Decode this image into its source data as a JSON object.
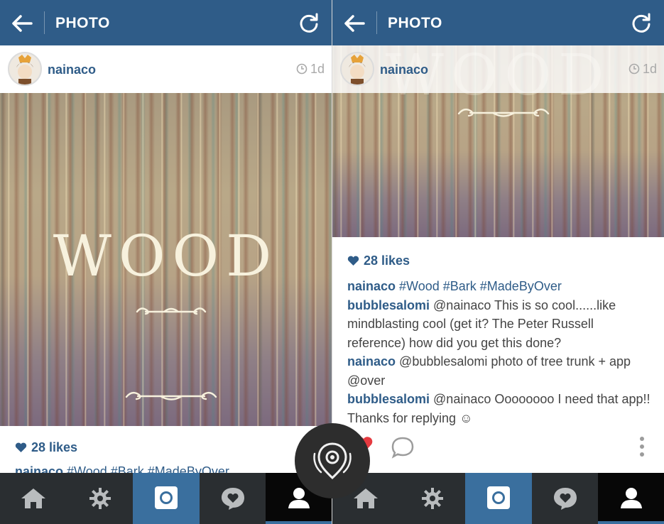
{
  "header": {
    "title": "PHOTO"
  },
  "post": {
    "username": "nainaco",
    "time": "1d",
    "image_text": "WOOD",
    "likes": "28 likes",
    "caption_user": "nainaco",
    "caption_tags": "#Wood #Bark #MadeByOver"
  },
  "comments": [
    {
      "user": "nainaco",
      "text": "#Wood #Bark #MadeByOver"
    },
    {
      "user": "bubblesalomi",
      "text": "@nainaco This is so cool......like mindblasting cool (get it? The Peter Russell reference) how did you get this done?"
    },
    {
      "user": "nainaco",
      "text": "@bubblesalomi photo of tree trunk + app @over"
    },
    {
      "user": "bubblesalomi",
      "text": "@nainaco Oooooooo I need that app!! Thanks for replying ☺"
    }
  ],
  "nav": {
    "items": [
      "home-icon",
      "explore-icon",
      "camera-icon",
      "activity-icon",
      "profile-icon"
    ]
  },
  "colors": {
    "header": "#2f5c88",
    "link": "#2f5c88",
    "nav": "#2a2e31",
    "nav_active": "#3a6f9e"
  }
}
